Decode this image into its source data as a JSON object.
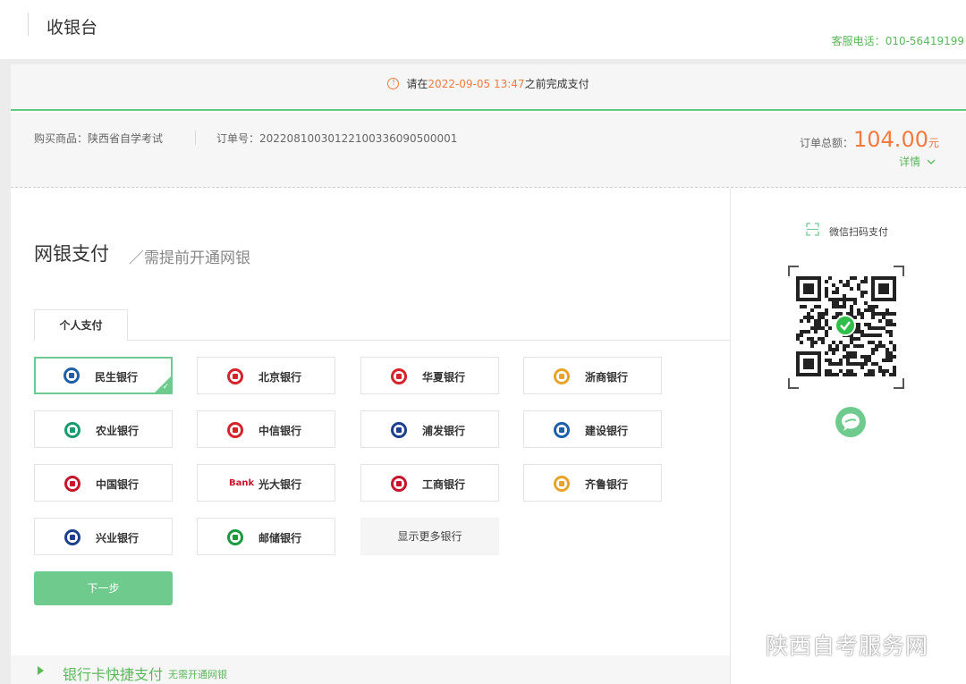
{
  "header": {
    "title": "收银台",
    "hotline_label": "客服电话：",
    "hotline_number": "010-56419199"
  },
  "deadline": {
    "prefix": "请在",
    "time": "2022-09-05 13:47",
    "suffix": "之前完成支付"
  },
  "order": {
    "product_label": "购买商品：",
    "product_value": "陕西省自学考试",
    "order_label": "订单号：",
    "order_value": "20220810030122100336090500001",
    "total_label": "订单总额：",
    "total_amount": "104.00",
    "total_unit": "元",
    "details_label": "详情"
  },
  "netbank": {
    "title": "网银支付",
    "subtitle": "／需提前开通网银",
    "tab_label": "个人支付",
    "banks": [
      {
        "name": "民生银行",
        "color": "#1f5fa8"
      },
      {
        "name": "北京银行",
        "color": "#d6232b"
      },
      {
        "name": "华夏银行",
        "color": "#d6232b"
      },
      {
        "name": "浙商银行",
        "color": "#e8a426"
      },
      {
        "name": "农业银行",
        "color": "#1a9a6e"
      },
      {
        "name": "中信银行",
        "color": "#d6232b"
      },
      {
        "name": "浦发银行",
        "color": "#1d3f8f"
      },
      {
        "name": "建设银行",
        "color": "#1d5fa8"
      },
      {
        "name": "中国银行",
        "color": "#c7162b"
      },
      {
        "name": "光大银行",
        "color": "#e8a426"
      },
      {
        "name": "工商银行",
        "color": "#c7162b"
      },
      {
        "name": "齐鲁银行",
        "color": "#e8a426"
      },
      {
        "name": "兴业银行",
        "color": "#1d3f8f"
      },
      {
        "name": "邮储银行",
        "color": "#1a9a3e"
      }
    ],
    "more_label": "显示更多银行",
    "next_label": "下一步",
    "brand_text_bank": "Bank"
  },
  "quickpay": {
    "label": "银行卡快捷支付",
    "hint": "无需开通网银"
  },
  "wechat": {
    "title": "微信扫码支付"
  },
  "watermark": {
    "text": "陕西自考服务网"
  },
  "colors": {
    "accent_green": "#6fcb8d",
    "accent_orange": "#f27a3f"
  }
}
